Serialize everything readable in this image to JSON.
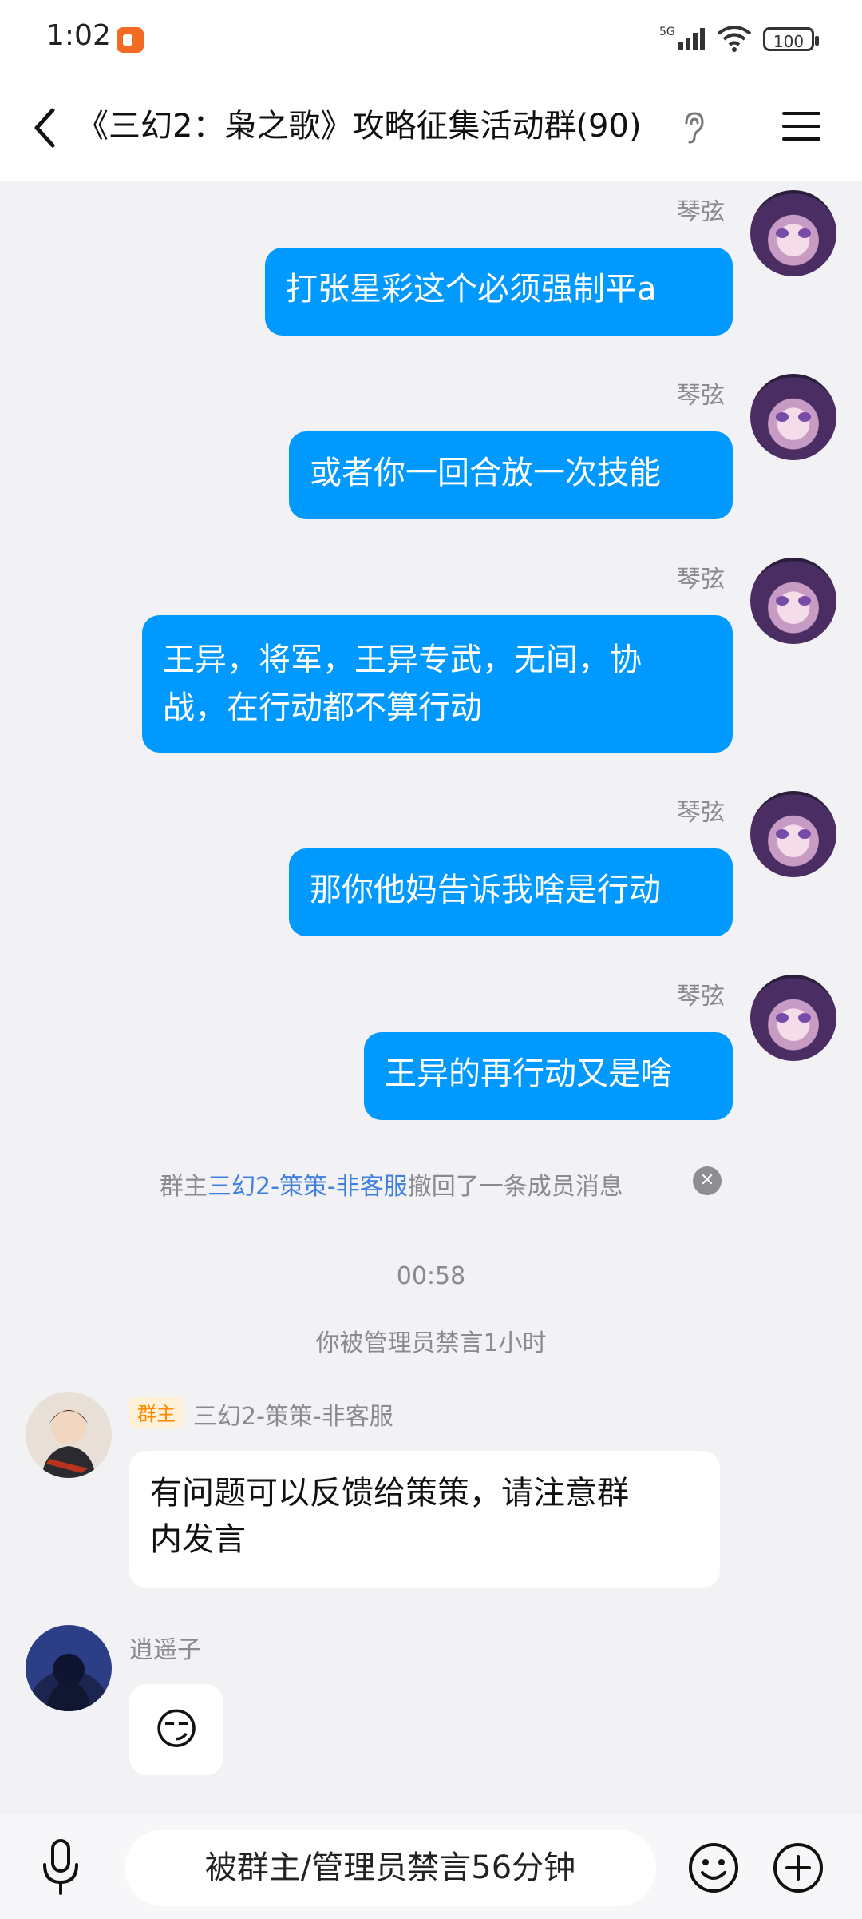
{
  "status_bar": {
    "time": "1:02",
    "network": "5G",
    "battery": "100"
  },
  "header": {
    "title": "《三幻2：枭之歌》攻略征集活动群(90)"
  },
  "messages": [
    {
      "sender": "琴弦",
      "text": "打张星彩这个必须强制平a"
    },
    {
      "sender": "琴弦",
      "text": "或者你一回合放一次技能"
    },
    {
      "sender": "琴弦",
      "text_lines": [
        "王异，将军，王异专武，无间，协",
        "战，在行动都不算行动"
      ]
    },
    {
      "sender": "琴弦",
      "text": "那你他妈告诉我啥是行动"
    },
    {
      "sender": "琴弦",
      "text": "王异的再行动又是啥"
    }
  ],
  "recall_notice": {
    "prefix": "群主",
    "name": "三幻2-策策-非客服",
    "suffix": "撤回了一条成员消息"
  },
  "timestamp": "00:58",
  "mute_notice": "你被管理员禁言1小时",
  "incoming": [
    {
      "badge": "群主",
      "sender": "三幻2-策策-非客服",
      "text_lines": [
        "有问题可以反馈给策策，请注意群",
        "内发言"
      ]
    },
    {
      "sender": "逍遥子",
      "emoji": "😏"
    }
  ],
  "input_bar": {
    "muted_text": "被群主/管理员禁言56分钟"
  },
  "icons": [
    "back-icon",
    "ear-icon",
    "menu-icon",
    "microphone-icon",
    "emoji-icon",
    "plus-icon",
    "close-icon"
  ],
  "colors": {
    "bubble_out": "#0099ff",
    "link": "#3f7fe0",
    "badge": "#ff8a00"
  }
}
